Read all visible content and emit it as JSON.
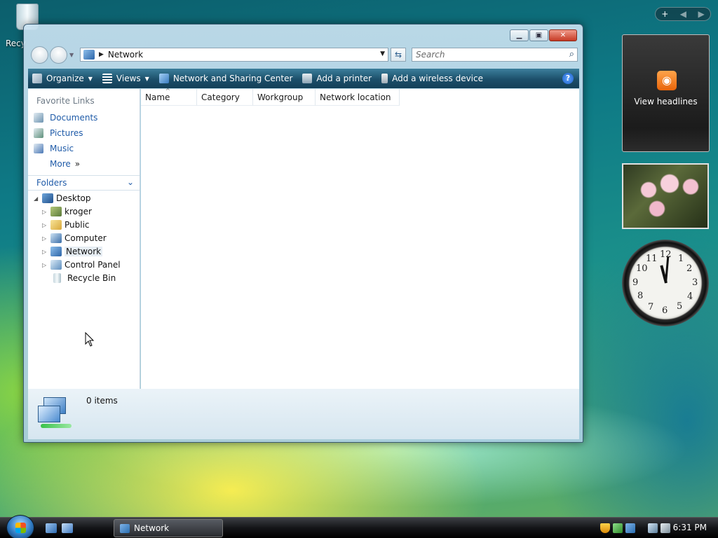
{
  "desktop": {
    "recycle_bin_label": "Recy"
  },
  "window": {
    "address": {
      "path_item": "Network"
    },
    "search": {
      "placeholder": "Search"
    },
    "toolbar": {
      "organize": "Organize",
      "views": "Views",
      "network_sharing": "Network and Sharing Center",
      "add_printer": "Add a printer",
      "add_wireless": "Add a wireless device"
    },
    "favorites": {
      "title": "Favorite Links",
      "items": [
        "Documents",
        "Pictures",
        "Music",
        "More"
      ]
    },
    "folders": {
      "title": "Folders",
      "tree": [
        "Desktop",
        "kroger",
        "Public",
        "Computer",
        "Network",
        "Control Panel",
        "Recycle Bin"
      ]
    },
    "columns": [
      "Name",
      "Category",
      "Workgroup",
      "Network location"
    ],
    "details": {
      "count": "0 items"
    }
  },
  "gadgets": {
    "feeds_label": "View headlines",
    "clock_numbers": [
      "12",
      "1",
      "2",
      "3",
      "4",
      "5",
      "6",
      "7",
      "8",
      "9",
      "10",
      "11"
    ]
  },
  "taskbar": {
    "task_button": "Network",
    "time": "6:31 PM"
  },
  "colors": {
    "toolbar": "#1c4f6a",
    "link": "#1f5ba8",
    "close_button": "#c63a24"
  }
}
